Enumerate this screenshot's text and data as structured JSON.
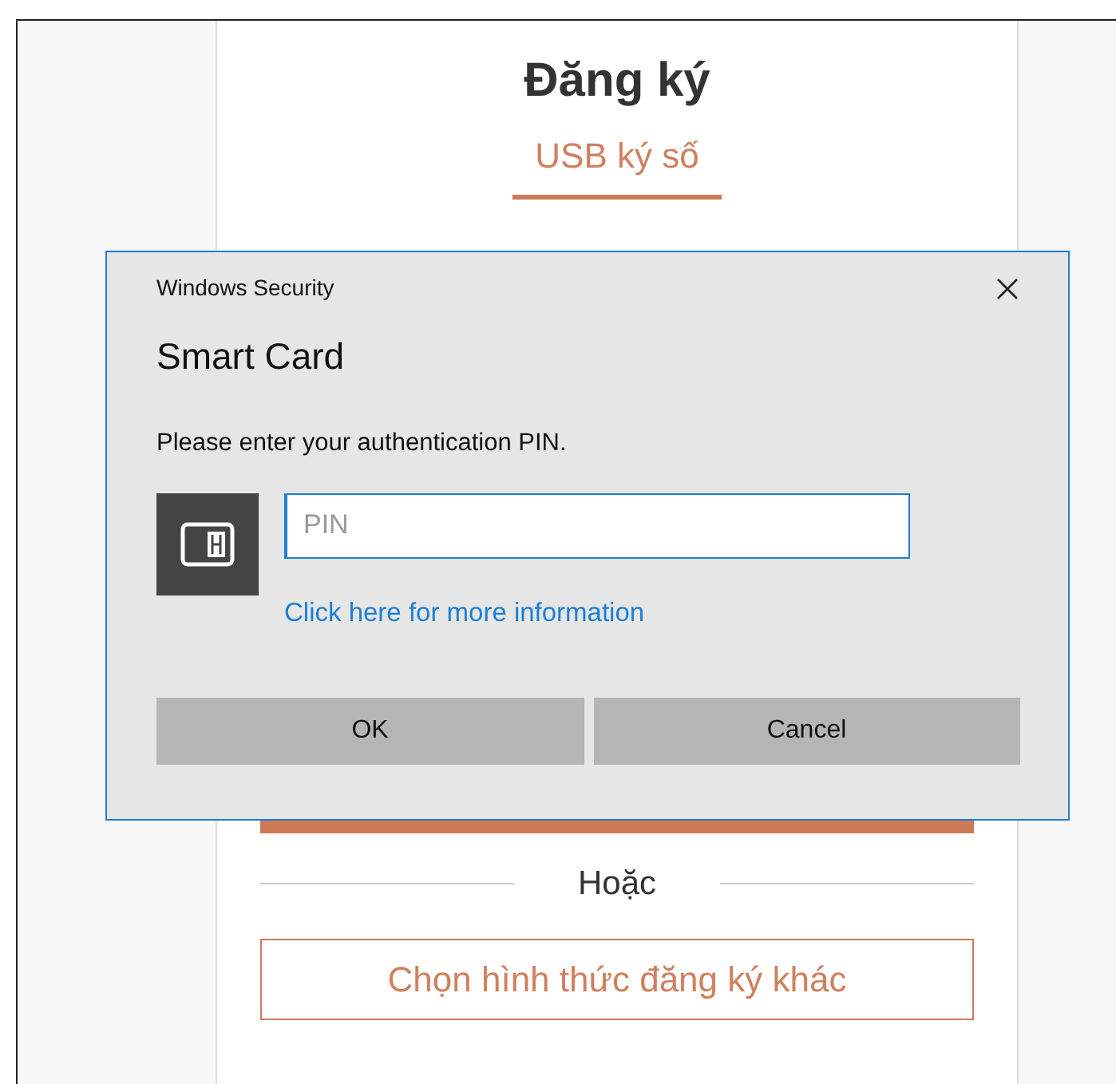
{
  "page": {
    "title": "Đăng ký",
    "tabs": [
      {
        "label": "USB ký số",
        "selected": true
      }
    ],
    "divider_text": "Hoặc",
    "alt_button": "Chọn hình thức đăng ký khác"
  },
  "dialog": {
    "app_title": "Windows Security",
    "heading": "Smart Card",
    "message": "Please enter your authentication PIN.",
    "pin_field": {
      "placeholder": "PIN"
    },
    "link": "Click here for more information",
    "buttons": [
      "OK",
      "Cancel"
    ]
  }
}
